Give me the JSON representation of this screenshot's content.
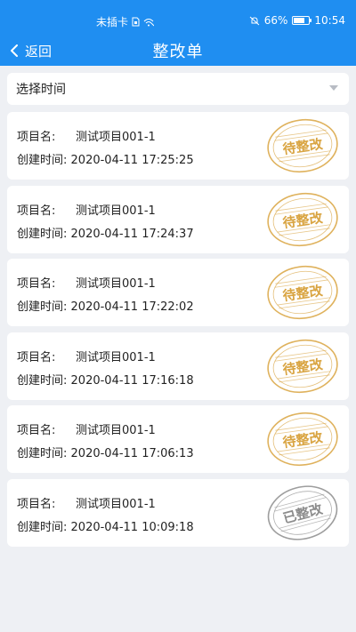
{
  "status_bar": {
    "carrier": "未插卡",
    "battery": "66%",
    "time": "10:54"
  },
  "nav": {
    "back_label": "返回",
    "title": "整改单"
  },
  "filter": {
    "label": "选择时间"
  },
  "labels": {
    "project_name": "项目名:",
    "created_time": "创建时间:"
  },
  "colors": {
    "header_bg": "#1f8ef1",
    "pending_stamp": "#d9a441",
    "done_stamp": "#8c8c8c"
  },
  "items": [
    {
      "project": "测试项目001-1",
      "created": "2020-04-11 17:25:25",
      "status": "待整改"
    },
    {
      "project": "测试项目001-1",
      "created": "2020-04-11 17:24:37",
      "status": "待整改"
    },
    {
      "project": "测试项目001-1",
      "created": "2020-04-11 17:22:02",
      "status": "待整改"
    },
    {
      "project": "测试项目001-1",
      "created": "2020-04-11 17:16:18",
      "status": "待整改"
    },
    {
      "project": "测试项目001-1",
      "created": "2020-04-11 17:06:13",
      "status": "待整改"
    },
    {
      "project": "测试项目001-1",
      "created": "2020-04-11 10:09:18",
      "status": "已整改"
    }
  ]
}
